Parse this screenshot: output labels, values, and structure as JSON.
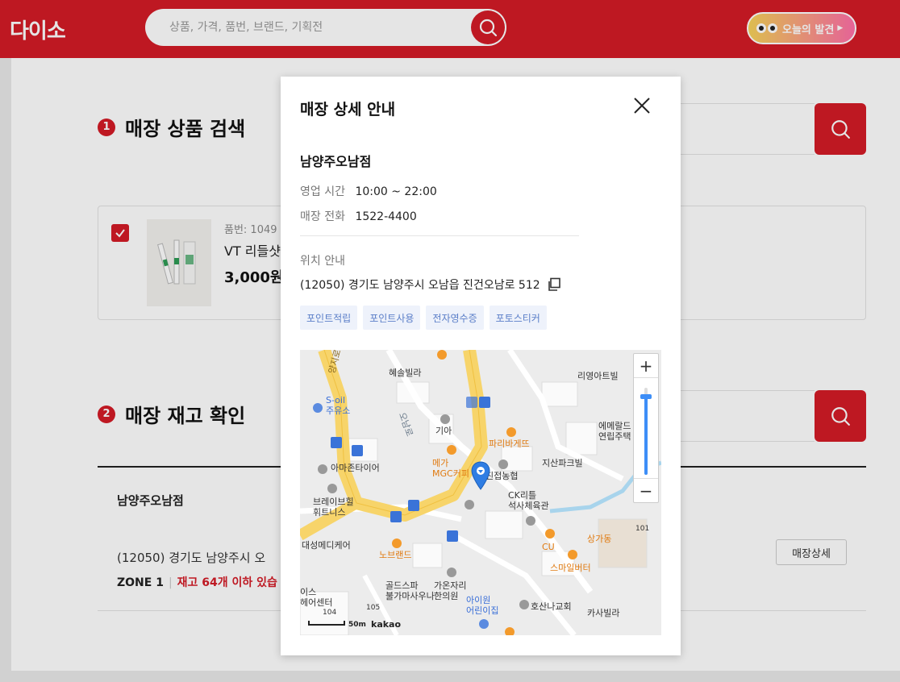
{
  "header": {
    "logo": "다이소",
    "search_placeholder": "상품, 가격, 품번, 브랜드, 기획전",
    "discover_label": "오늘의 발견"
  },
  "page": {
    "step1": {
      "num": "1",
      "title": "매장 상품 검색"
    },
    "product": {
      "code": "품번: 1049",
      "name": "VT 리들샷",
      "price": "3,000원"
    },
    "step2": {
      "num": "2",
      "title": "매장 재고 확인"
    },
    "store": {
      "name": "남양주오남점",
      "address": "(12050) 경기도 남양주시 오",
      "zone_label": "ZONE 1",
      "zone_stock": "재고 64개 이하 있습",
      "detail_button": "매장상세"
    }
  },
  "modal": {
    "title": "매장 상세 안내",
    "store_name": "남양주오남점",
    "hours_label": "영업 시간",
    "hours_value": "10:00 ~ 22:00",
    "phone_label": "매장 전화",
    "phone_value": "1522-4400",
    "location_label": "위치 안내",
    "address": "(12050) 경기도 남양주시 오남읍 진건오남로 512",
    "tags": [
      "포인트적립",
      "포인트사용",
      "전자영수증",
      "포토스티커"
    ]
  },
  "map": {
    "zoom_level": 0.9,
    "scale_text": "50m",
    "attribution": "kakao",
    "labels": {
      "hesol": "혜솔빌라",
      "liyoung": "리영아트빌",
      "soil": "S-oil\n주유소",
      "kia": "기아",
      "paris": "파리바게뜨",
      "emerald": "에메랄드\n연립주택",
      "amazon": "아마존타이어",
      "mega": "메가\nMGC커피",
      "jinjeop": "진접농협",
      "jisan": "지산파크빌",
      "brave": "브레이브힐\n휘트니스",
      "ck": "CK리틀\n석사체육관",
      "sanggadong": "상가동",
      "daesung": "대성메디케어",
      "cu": "CU",
      "noble": "노브랜드",
      "smile": "스마일버터",
      "golf": "골드스파\n불가마사우나",
      "gaon": "가온자리\n한의원",
      "aiwon": "아이원\n어린이집",
      "hosan": "호산나교회",
      "casa": "카사빌라",
      "ice": "이스\n헤어센터",
      "road1": "양지로",
      "road2": "오남로",
      "n104": "104",
      "n105": "105",
      "n101": "101"
    }
  }
}
